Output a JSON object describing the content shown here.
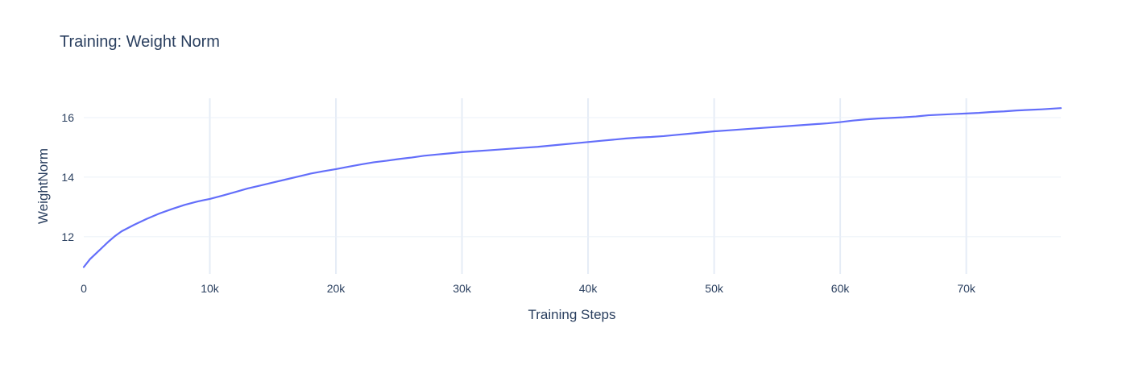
{
  "chart_data": {
    "type": "line",
    "title": "Training: Weight Norm",
    "xlabel": "Training Steps",
    "ylabel": "WeightNorm",
    "xlim": [
      0,
      77500
    ],
    "ylim": [
      10.75,
      16.65
    ],
    "x_ticks": [
      0,
      10000,
      20000,
      30000,
      40000,
      50000,
      60000,
      70000
    ],
    "x_tick_labels": [
      "0",
      "10k",
      "20k",
      "30k",
      "40k",
      "50k",
      "60k",
      "70k"
    ],
    "y_ticks": [
      12,
      14,
      16
    ],
    "y_tick_labels": [
      "12",
      "14",
      "16"
    ],
    "grid": true,
    "legend": "none",
    "colors": {
      "line": "#636efa",
      "text": "#2a3f5f",
      "grid": "#ebf0f8"
    },
    "series": [
      {
        "x": [
          0,
          500,
          1000,
          1500,
          2000,
          2500,
          3000,
          4000,
          5000,
          6000,
          7000,
          8000,
          9000,
          10000,
          11000,
          12000,
          13000,
          14000,
          15000,
          16000,
          17000,
          18000,
          19000,
          20000,
          21000,
          22000,
          23000,
          24000,
          25000,
          26000,
          27000,
          28000,
          29000,
          30000,
          31000,
          32000,
          33000,
          34000,
          35000,
          36000,
          37000,
          38000,
          39000,
          40000,
          41000,
          42000,
          43000,
          44000,
          45000,
          46000,
          47000,
          48000,
          49000,
          50000,
          51000,
          52000,
          53000,
          54000,
          55000,
          56000,
          57000,
          58000,
          59000,
          60000,
          61000,
          62000,
          63000,
          64000,
          65000,
          66000,
          67000,
          68000,
          69000,
          70000,
          71000,
          72000,
          73000,
          74000,
          75000,
          76000,
          77500
        ],
        "y": [
          10.98,
          11.25,
          11.45,
          11.65,
          11.85,
          12.03,
          12.18,
          12.4,
          12.6,
          12.78,
          12.93,
          13.07,
          13.18,
          13.27,
          13.38,
          13.5,
          13.62,
          13.72,
          13.82,
          13.92,
          14.02,
          14.12,
          14.2,
          14.27,
          14.35,
          14.43,
          14.5,
          14.55,
          14.61,
          14.66,
          14.72,
          14.76,
          14.8,
          14.84,
          14.87,
          14.9,
          14.93,
          14.96,
          14.99,
          15.02,
          15.06,
          15.1,
          15.14,
          15.18,
          15.22,
          15.26,
          15.3,
          15.33,
          15.35,
          15.38,
          15.42,
          15.46,
          15.5,
          15.54,
          15.57,
          15.6,
          15.63,
          15.66,
          15.69,
          15.72,
          15.75,
          15.78,
          15.81,
          15.85,
          15.9,
          15.94,
          15.97,
          15.99,
          16.01,
          16.04,
          16.08,
          16.1,
          16.12,
          16.14,
          16.16,
          16.19,
          16.21,
          16.24,
          16.26,
          16.28,
          16.32
        ]
      }
    ]
  }
}
